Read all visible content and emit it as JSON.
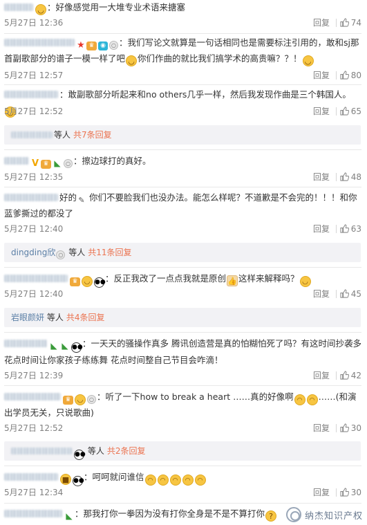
{
  "ui": {
    "reply_label": "回复",
    "others_word": "等人",
    "accent_color": "#eb7350",
    "muted_color": "#808080"
  },
  "comments": [
    {
      "text": "好像感觉用一大堆专业术语来搪塞",
      "time": "5月27日 12:36",
      "likes": "74"
    },
    {
      "text": "我们写论文就算是一句话相同也是需要标注引用的，敢和sj那首副歌部分的谱子一模一样了吧",
      "text2": "你们作曲的就比我们搞学术的高贵嘛？？！",
      "time": "5月27日 12:57",
      "likes": "80"
    },
    {
      "text": "敢副歌部分听起来和no others几乎一样，然后我发现作曲是三个韩国人。",
      "time": "5月27日 12:52",
      "likes": "65"
    },
    {
      "text": "擦边球打的真好。",
      "time": "5月27日 12:35",
      "likes": "48"
    },
    {
      "text_a": "好的",
      "text_b": "你们不要脸我们也没办法。能怎么样呢？不道歉是不会完的！！！和你蓝爹撕过的都没了",
      "time": "5月27日 12:40",
      "likes": "63"
    },
    {
      "text": "反正我改了一点点我就是原创",
      "text2": "这样来解释吗？",
      "time": "5月27日 12:40",
      "likes": "45"
    },
    {
      "text": "一天天的骚操作真多 腾讯创造营是真的怕糊怕死了吗？有这时间抄袭多花点时间让你家孩子练练舞 花点时间整自己节目会咋滴！",
      "time": "5月27日 12:39",
      "likes": "42"
    },
    {
      "text": "听了一下how to break a heart ……真的好像啊",
      "text2": "……(和演出学员无关，只说歌曲)",
      "time": "5月27日 12:52",
      "likes": "30"
    },
    {
      "text": "呵呵就问谁信",
      "time": "5月27日 12:34",
      "likes": "30"
    },
    {
      "text": "那我打你一拳因为没有打你全身是不是不算打你"
    }
  ],
  "subreplies": [
    {
      "total": "共7条回复"
    },
    {
      "name": "dingding欣",
      "total": "共11条回复"
    },
    {
      "name": "岩眼颜妍",
      "total": "共4条回复"
    },
    {
      "total": "共2条回复"
    }
  ],
  "icons": [
    "smile-icon",
    "crown-badge-icon",
    "star-icon",
    "eye-badge-icon",
    "medal-icon",
    "v-badge-icon",
    "watermelon-icon",
    "panda-icon",
    "hand-icon",
    "thumb-up-icon",
    "laugh-icon",
    "confused-icon"
  ],
  "watermark": {
    "text": "纳杰知识产权"
  }
}
